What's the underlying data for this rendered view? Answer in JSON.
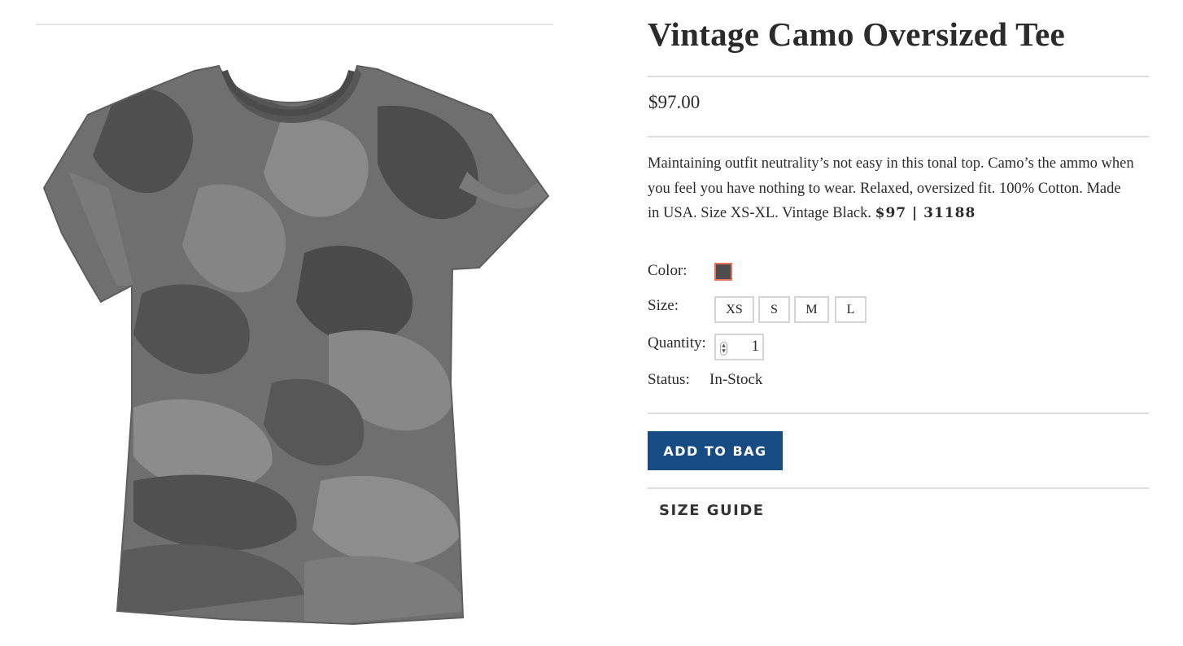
{
  "product": {
    "title": "Vintage Camo Oversized Tee",
    "price": "$97.00",
    "description_text": "Maintaining outfit neutrality’s not easy in this tonal top. Camo’s the ammo when you feel you have nothing to wear. Relaxed, oversized fit. 100% Cotton. Made in USA. Size XS-XL. Vintage Black.",
    "description_code": "$97 | 31188",
    "image_icon": "camo-tshirt-image"
  },
  "options": {
    "color_label": "Color:",
    "color_swatch": "#4d4d4d",
    "color_swatch_border": "#e8735a",
    "size_label": "Size:",
    "sizes": [
      "XS",
      "S",
      "M",
      "L"
    ],
    "quantity_label": "Quantity:",
    "quantity_value": "1",
    "status_label": "Status:",
    "status_value": "In-Stock"
  },
  "actions": {
    "add_to_bag": "ADD TO BAG",
    "size_guide": "SIZE GUIDE",
    "accent_color": "#174b83"
  }
}
